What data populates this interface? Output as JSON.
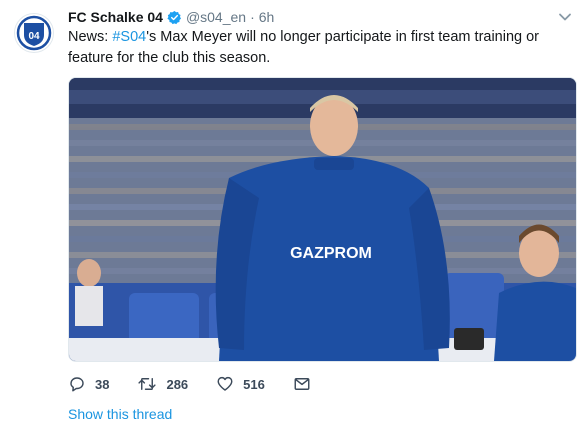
{
  "tweet": {
    "display_name": "FC Schalke 04",
    "handle": "@s04_en",
    "separator": "·",
    "time": "6h",
    "text_prefix": "News: ",
    "hashtag": "#S04",
    "text_suffix": "'s Max Meyer will no longer participate in first team training or feature for the club this season.",
    "avatar_logo_text": "04",
    "image_sponsor_text": "GAZPROM",
    "actions": {
      "replies": "38",
      "retweets": "286",
      "likes": "516"
    },
    "show_thread": "Show this thread"
  },
  "colors": {
    "link": "#1b95e0",
    "schalke_blue": "#1d4fa3",
    "muted": "#657786"
  },
  "icons": [
    "schalke-logo-icon",
    "verified-badge-icon",
    "chevron-down-icon",
    "reply-icon",
    "retweet-icon",
    "like-icon",
    "direct-message-icon"
  ]
}
